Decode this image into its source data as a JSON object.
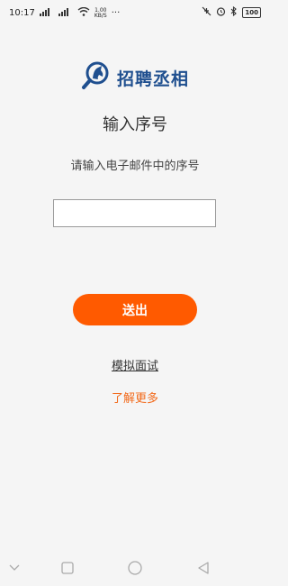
{
  "status": {
    "time": "10:17",
    "network_speed_value": "1.00",
    "network_speed_unit": "KB/S",
    "more_indicator": "···",
    "battery": "100"
  },
  "logo": {
    "text": "招聘丞相"
  },
  "main": {
    "title": "输入序号",
    "subtitle": "请输入电子邮件中的序号",
    "input_value": "",
    "submit_label": "送出",
    "mock_interview_label": "模拟面试",
    "learn_more_label": "了解更多"
  },
  "colors": {
    "accent": "#ff5a00",
    "brand": "#1f4f8f",
    "link_orange": "#f26a1b"
  },
  "icons": {
    "logo": "horse-head-magnifier-icon",
    "nav_down": "chevron-down-icon",
    "nav_recent": "square-icon",
    "nav_home": "circle-icon",
    "nav_back": "triangle-back-icon"
  }
}
